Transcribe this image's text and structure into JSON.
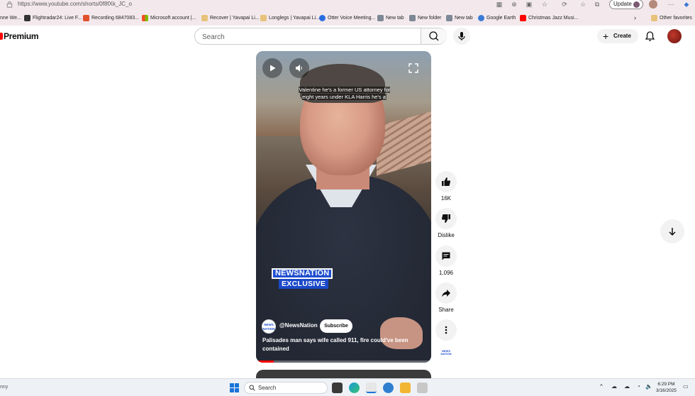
{
  "browser": {
    "url": "https://www.youtube.com/shorts/0f8fXk_JC_o",
    "update_label": "Update",
    "bookmarks": [
      {
        "label": "nne We...",
        "color": "#cc3a3a"
      },
      {
        "label": "Flightradar24: Live F...",
        "color": "#333333"
      },
      {
        "label": "Recording 6847083...",
        "color": "#e0502a"
      },
      {
        "label": "Microsoft account |...",
        "color": "#4b8be0"
      },
      {
        "label": "Recover | Yavapai Li...",
        "color": "#e8c27a"
      },
      {
        "label": "Longlegs | Yavapai Li...",
        "color": "#e8c27a"
      },
      {
        "label": "Otter Voice Meeting...",
        "color": "#2b6de0"
      },
      {
        "label": "New tab",
        "color": "#7d8896"
      },
      {
        "label": "New folder",
        "color": "#7d8896"
      },
      {
        "label": "New tab",
        "color": "#7d8896"
      },
      {
        "label": "Google Earth",
        "color": "#3a7bd5"
      },
      {
        "label": "Christmas Jazz Musi...",
        "color": "#ff0000"
      }
    ],
    "other_favorites": "Other favorites"
  },
  "header": {
    "logo_text": "Premium",
    "search_placeholder": "Search",
    "create_label": "Create"
  },
  "player": {
    "caption": "Valentine he's a former US attorney for eight years under KLA Harris he's a",
    "badge_top": "NEWSNATION",
    "badge_bottom": "EXCLUSIVE",
    "channel_avatar_text": "NEWS NATION",
    "channel_name": "@NewsNation",
    "subscribe_label": "Subscribe",
    "title": "Palisades man says wife called 911, fire could've been contained",
    "progress_fraction": 0.1
  },
  "actions": {
    "like_count": "16K",
    "dislike_label": "Dislike",
    "comment_count": "1,096",
    "share_label": "Share",
    "channel_mini": "NEWS NATION"
  },
  "taskbar": {
    "left_text": "nny",
    "search_label": "Search",
    "time": "6:29 PM",
    "date": "3/16/2025"
  },
  "colors": {
    "accent_red": "#ff0000",
    "newsnation_blue": "#1f4fd0"
  }
}
